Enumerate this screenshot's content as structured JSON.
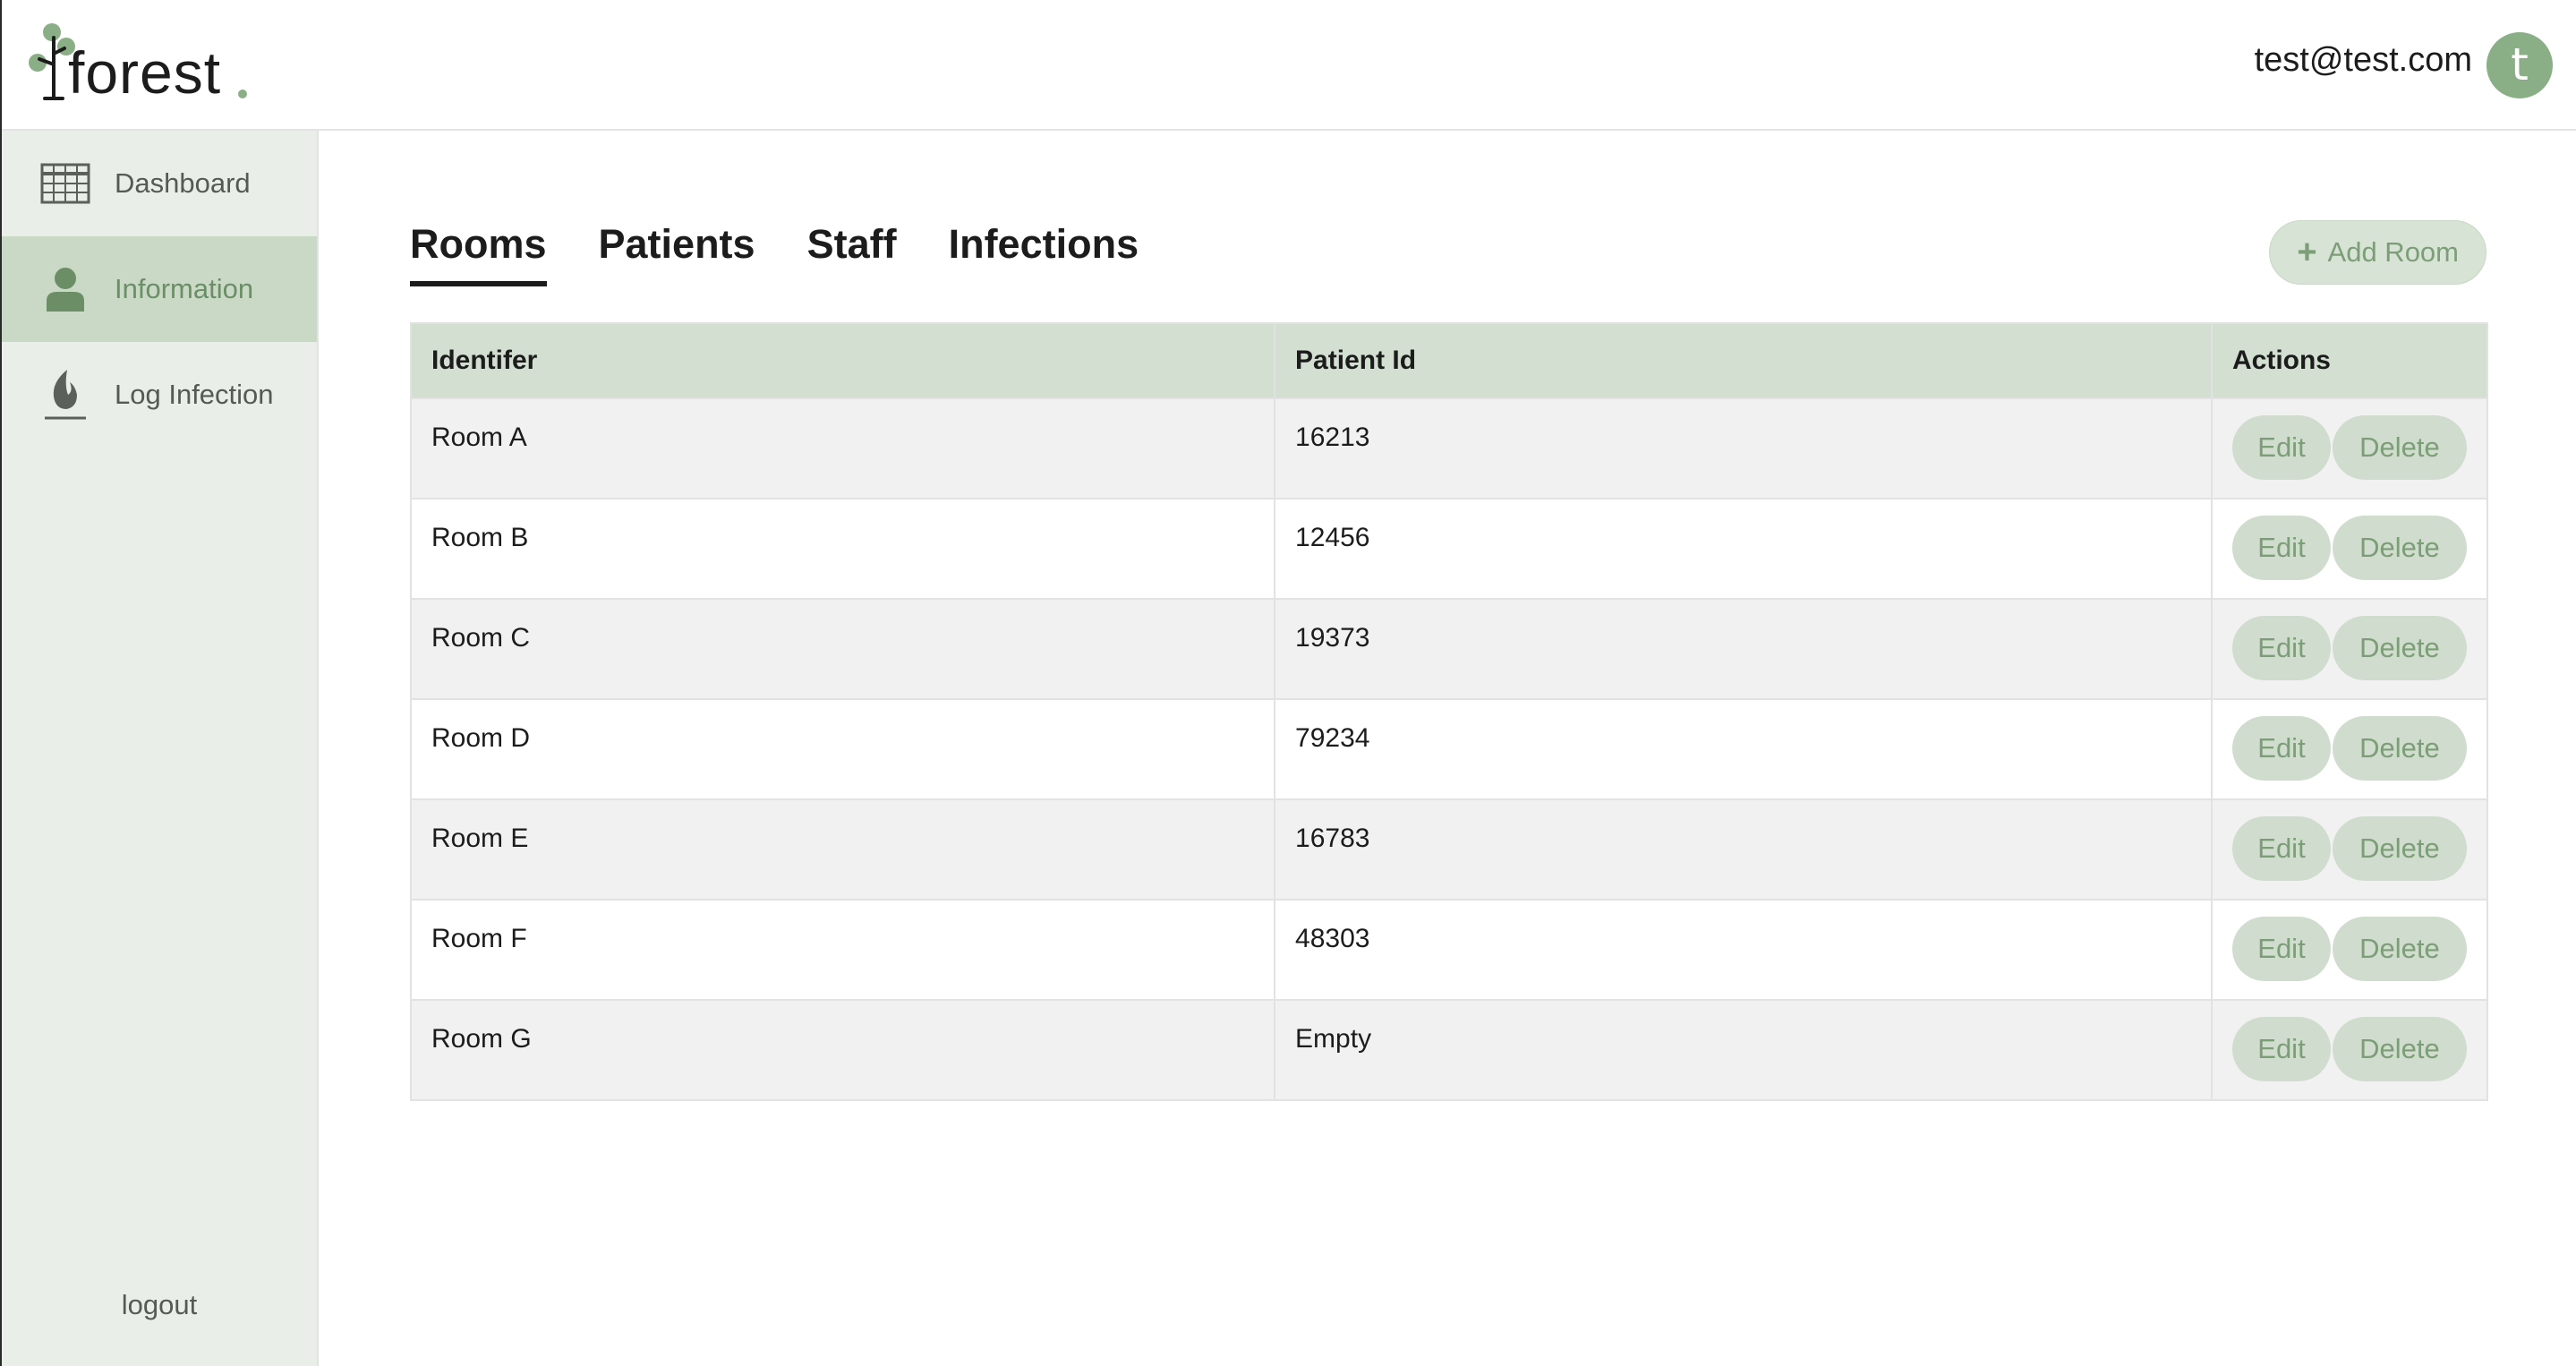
{
  "header": {
    "logo_text": "forest",
    "user_email": "test@test.com",
    "avatar_initial": "t"
  },
  "sidebar": {
    "items": [
      {
        "label": "Dashboard",
        "icon": "grid-icon",
        "active": false
      },
      {
        "label": "Information",
        "icon": "person-icon",
        "active": true
      },
      {
        "label": "Log Infection",
        "icon": "flame-icon",
        "active": false
      }
    ],
    "logout_label": "logout"
  },
  "tabs": [
    {
      "label": "Rooms",
      "active": true
    },
    {
      "label": "Patients",
      "active": false
    },
    {
      "label": "Staff",
      "active": false
    },
    {
      "label": "Infections",
      "active": false
    }
  ],
  "add_button": {
    "label": "Add Room",
    "icon": "plus-icon"
  },
  "table": {
    "headers": [
      "Identifer",
      "Patient Id",
      "Actions"
    ],
    "rows": [
      {
        "identifier": "Room A",
        "patient_id": "16213"
      },
      {
        "identifier": "Room B",
        "patient_id": "12456"
      },
      {
        "identifier": "Room C",
        "patient_id": "19373"
      },
      {
        "identifier": "Room D",
        "patient_id": "79234"
      },
      {
        "identifier": "Room E",
        "patient_id": "16783"
      },
      {
        "identifier": "Room F",
        "patient_id": "48303"
      },
      {
        "identifier": "Room G",
        "patient_id": "Empty"
      }
    ],
    "edit_label": "Edit",
    "delete_label": "Delete"
  },
  "colors": {
    "accent": "#8aae85",
    "sidebar_bg": "#e9eee8",
    "sidebar_active": "#c9d9c6",
    "table_header": "#d3e0d1",
    "button_bg": "#d0dccd",
    "button_text": "#7c9e77"
  }
}
